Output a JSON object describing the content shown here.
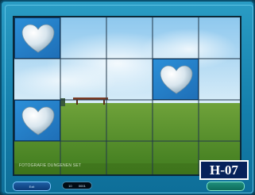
{
  "game": {
    "level_label": "H-07",
    "credit_text": "FOTOGRAFIE DUNGENEN SET",
    "grid": {
      "columns": 4,
      "rows": 3
    },
    "revealed_cells": [
      {
        "row": 0,
        "col": 0,
        "icon": "heart-stone-icon"
      },
      {
        "row": 1,
        "col": 3,
        "icon": "heart-stone-icon"
      },
      {
        "row": 2,
        "col": 0,
        "icon": "heart-stone-icon"
      }
    ]
  },
  "controls": {
    "left_button_label": "Exit",
    "counter_left": "10",
    "counter_right": "0001",
    "right_button_label": ""
  },
  "colors": {
    "frame": "#1580ad",
    "tile": "#2b8fd8",
    "badge": "#06225a"
  }
}
